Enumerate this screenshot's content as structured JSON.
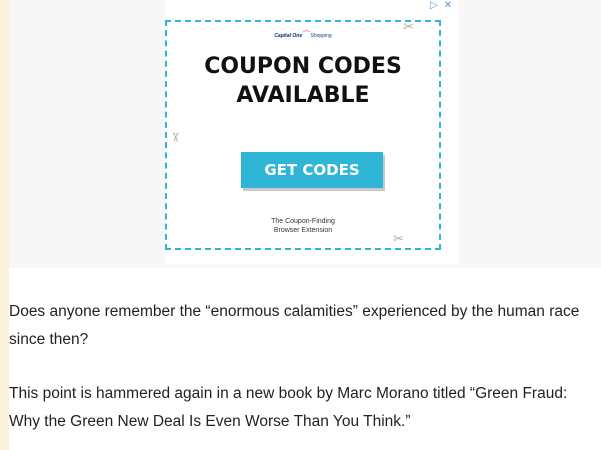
{
  "ad": {
    "logo_brand": "Capital One",
    "logo_sub": "Shopping",
    "headline_line1": "COUPON CODES",
    "headline_line2": "AVAILABLE",
    "cta_label": "GET CODES",
    "footer_line1": "The Coupon-Finding",
    "footer_line2": "Browser Extension",
    "adchoices_icon": "adchoices-icon",
    "close_icon": "close-icon",
    "accent_color": "#2fb6d6"
  },
  "article": {
    "paragraph1": "Does anyone remember the “enormous calamities” experienced by the human race since then?",
    "paragraph2": "This point is hammered again in a new book by Marc Morano titled “Green Fraud: Why the Green New Deal Is Even Worse Than You Think.”"
  }
}
